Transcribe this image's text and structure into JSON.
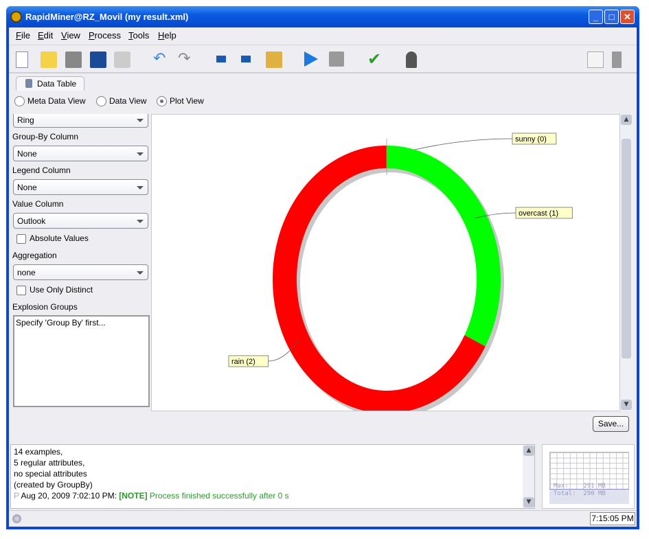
{
  "window": {
    "title": "RapidMiner@RZ_Movil (my result.xml)"
  },
  "menu": [
    "File",
    "Edit",
    "View",
    "Process",
    "Tools",
    "Help"
  ],
  "tab": {
    "label": "Data Table"
  },
  "views": [
    {
      "label": "Meta Data View",
      "selected": false
    },
    {
      "label": "Data View",
      "selected": false
    },
    {
      "label": "Plot View",
      "selected": true
    }
  ],
  "settings": {
    "plotter": "Ring",
    "group_by_label": "Group-By Column",
    "group_by": "None",
    "legend_label": "Legend Column",
    "legend": "None",
    "value_label": "Value Column",
    "value": "Outlook",
    "absolute_values": "Absolute Values",
    "aggregation_label": "Aggregation",
    "aggregation": "none",
    "use_distinct": "Use Only Distinct",
    "explosion_label": "Explosion Groups",
    "explosion_text": "Specify 'Group By' first..."
  },
  "chart_data": {
    "type": "pie",
    "variant": "ring",
    "categories": [
      "sunny (0)",
      "overcast (1)",
      "rain (2)"
    ],
    "values": [
      0,
      1,
      2
    ],
    "colors": [
      "#00ff00",
      "#00ff00",
      "#ff0000"
    ]
  },
  "save_label": "Save...",
  "log": {
    "lines": [
      "14 examples,",
      "5 regular attributes,",
      "no special attributes",
      "(created by GroupBy)"
    ],
    "prefix": "P",
    "timestamp": "Aug 20, 2009 7:02:10 PM:",
    "tag": "[NOTE]",
    "message": "Process finished successfully after 0 s"
  },
  "memory": {
    "max": "Max:    291 MB",
    "total": "Total:  290 MB"
  },
  "clock": "7:15:05 PM"
}
